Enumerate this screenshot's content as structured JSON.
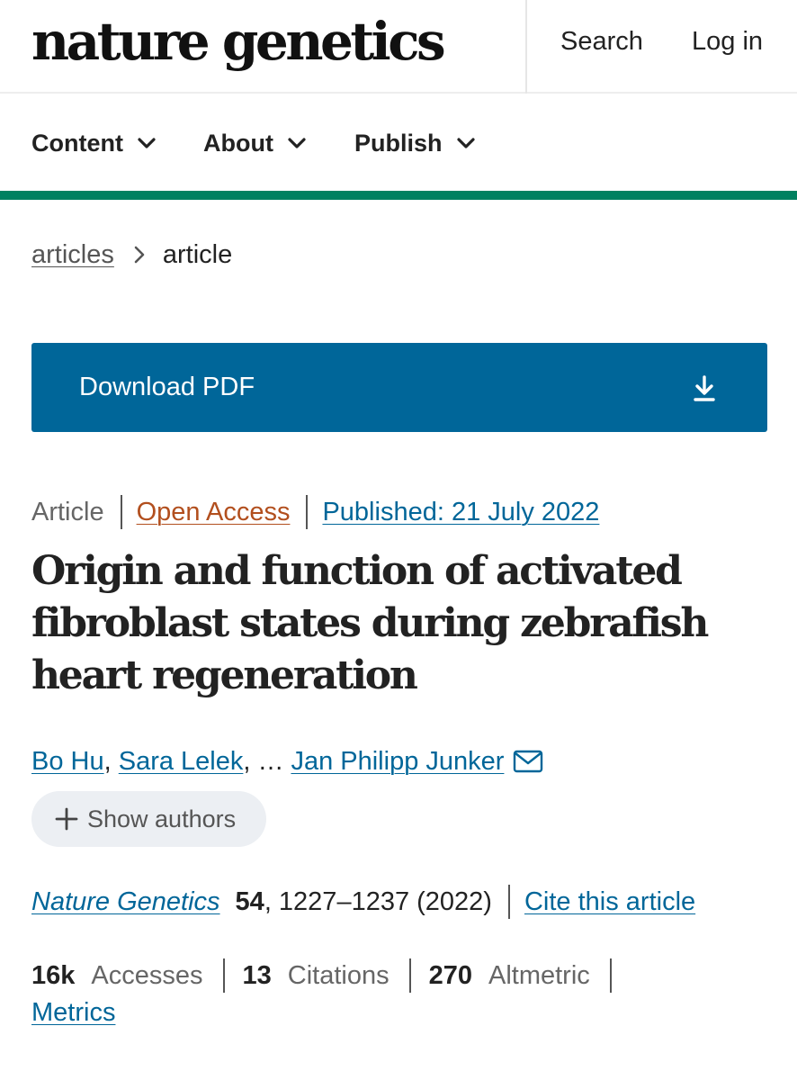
{
  "header": {
    "logo": "nature genetics",
    "search_label": "Search",
    "login_label": "Log in"
  },
  "nav": {
    "items": [
      {
        "label": "Content"
      },
      {
        "label": "About"
      },
      {
        "label": "Publish"
      }
    ]
  },
  "breadcrumb": {
    "parent": "articles",
    "current": "article"
  },
  "download": {
    "label": "Download PDF"
  },
  "article": {
    "type": "Article",
    "access": "Open Access",
    "published": "Published: 21 July 2022",
    "title": "Origin and function of activated fibroblast states during zebrafish heart regeneration",
    "authors": {
      "first": "Bo Hu",
      "second": "Sara Lelek",
      "ellipsis": "…",
      "last": "Jan Philipp Junker",
      "show_authors_label": "Show authors"
    },
    "citation": {
      "journal": "Nature Genetics",
      "volume": "54",
      "pages": ", 1227–1237 (2022)",
      "cite_label": "Cite this article"
    },
    "metrics": {
      "accesses_value": "16k",
      "accesses_label": "Accesses",
      "citations_value": "13",
      "citations_label": "Citations",
      "altmetric_value": "270",
      "altmetric_label": "Altmetric",
      "metrics_link": "Metrics"
    }
  },
  "colors": {
    "brand_green": "#008160",
    "primary_blue": "#006699",
    "open_access_orange": "#b24f1e"
  },
  "icons": {
    "nav_chevron": "chevron-down-icon",
    "breadcrumb_separator": "chevron-right-icon",
    "download": "download-icon",
    "email": "mail-icon",
    "show_authors": "plus-icon"
  }
}
